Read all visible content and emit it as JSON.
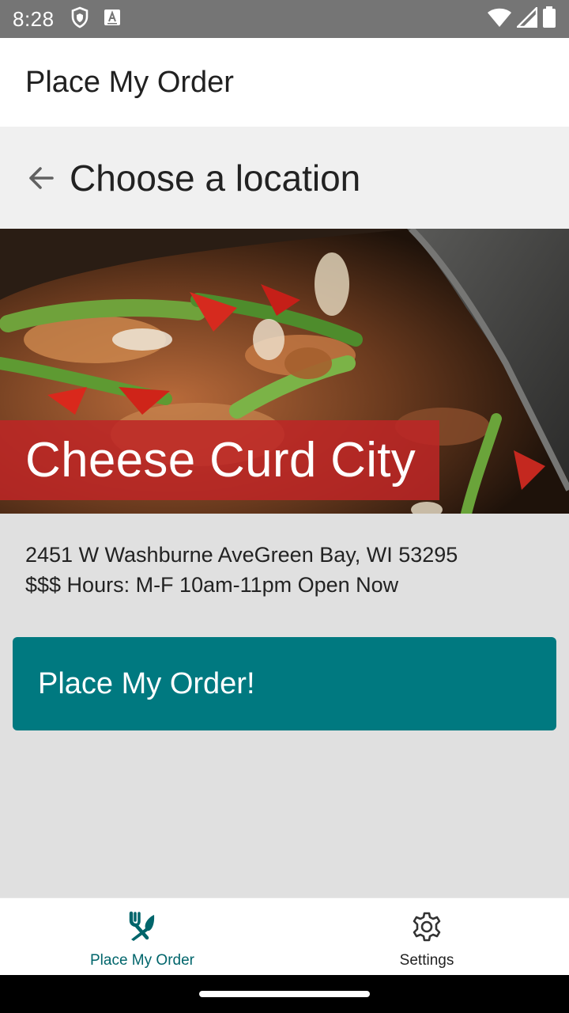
{
  "status_bar": {
    "time": "8:28",
    "left_icons": [
      "shield-icon",
      "keyboard-a-icon"
    ],
    "right_icons": [
      "wifi-icon",
      "signal-icon",
      "battery-icon"
    ]
  },
  "app_bar": {
    "title": "Place My Order"
  },
  "sub_header": {
    "back_icon": "arrow-back-icon",
    "title": "Choose a location"
  },
  "restaurant": {
    "name": "Cheese Curd City",
    "address": "2451 W Washburne AveGreen Bay, WI 53295",
    "info": "$$$ Hours: M-F 10am-11pm Open Now"
  },
  "order_button": {
    "label": "Place My Order!"
  },
  "bottom_nav": {
    "items": [
      {
        "label": "Place My Order",
        "icon": "fork-knife-icon",
        "active": true
      },
      {
        "label": "Settings",
        "icon": "gear-icon",
        "active": false
      }
    ]
  },
  "colors": {
    "primary": "#007980",
    "banner_red": "#be2626",
    "status_bar": "#757575",
    "active_nav": "#00656b"
  }
}
